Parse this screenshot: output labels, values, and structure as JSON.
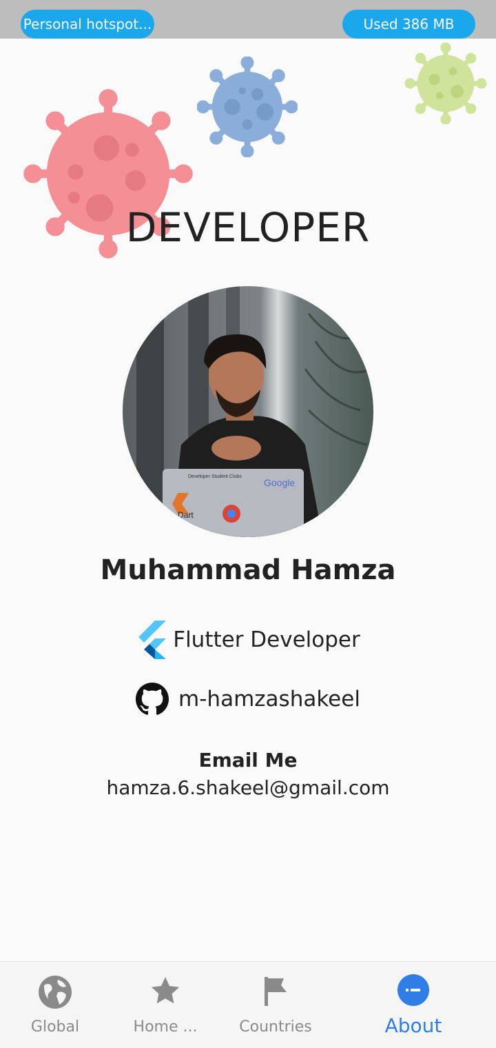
{
  "status_bar": {
    "hotspot_label": "Personal hotspot...",
    "data_usage": "Used  386 MB"
  },
  "page_title": "DEVELOPER",
  "profile": {
    "name": "Muhammad Hamza",
    "role": "Flutter Developer",
    "github": "m-hamzashakeel",
    "email_heading": "Email Me",
    "email": "hamza.6.shakeel@gmail.com"
  },
  "decor": {
    "virus_colors": [
      "#f48f95",
      "#8aaed9",
      "#cfe39a"
    ]
  },
  "bottom_nav": {
    "items": [
      {
        "label": "Global",
        "icon": "globe-icon"
      },
      {
        "label": "Home ...",
        "icon": "star-icon"
      },
      {
        "label": "Countries",
        "icon": "flag-icon"
      },
      {
        "label": "About",
        "icon": "about-icon",
        "active": true
      }
    ],
    "active_color": "#2f7ee6",
    "inactive_color": "#8a8a8a"
  }
}
